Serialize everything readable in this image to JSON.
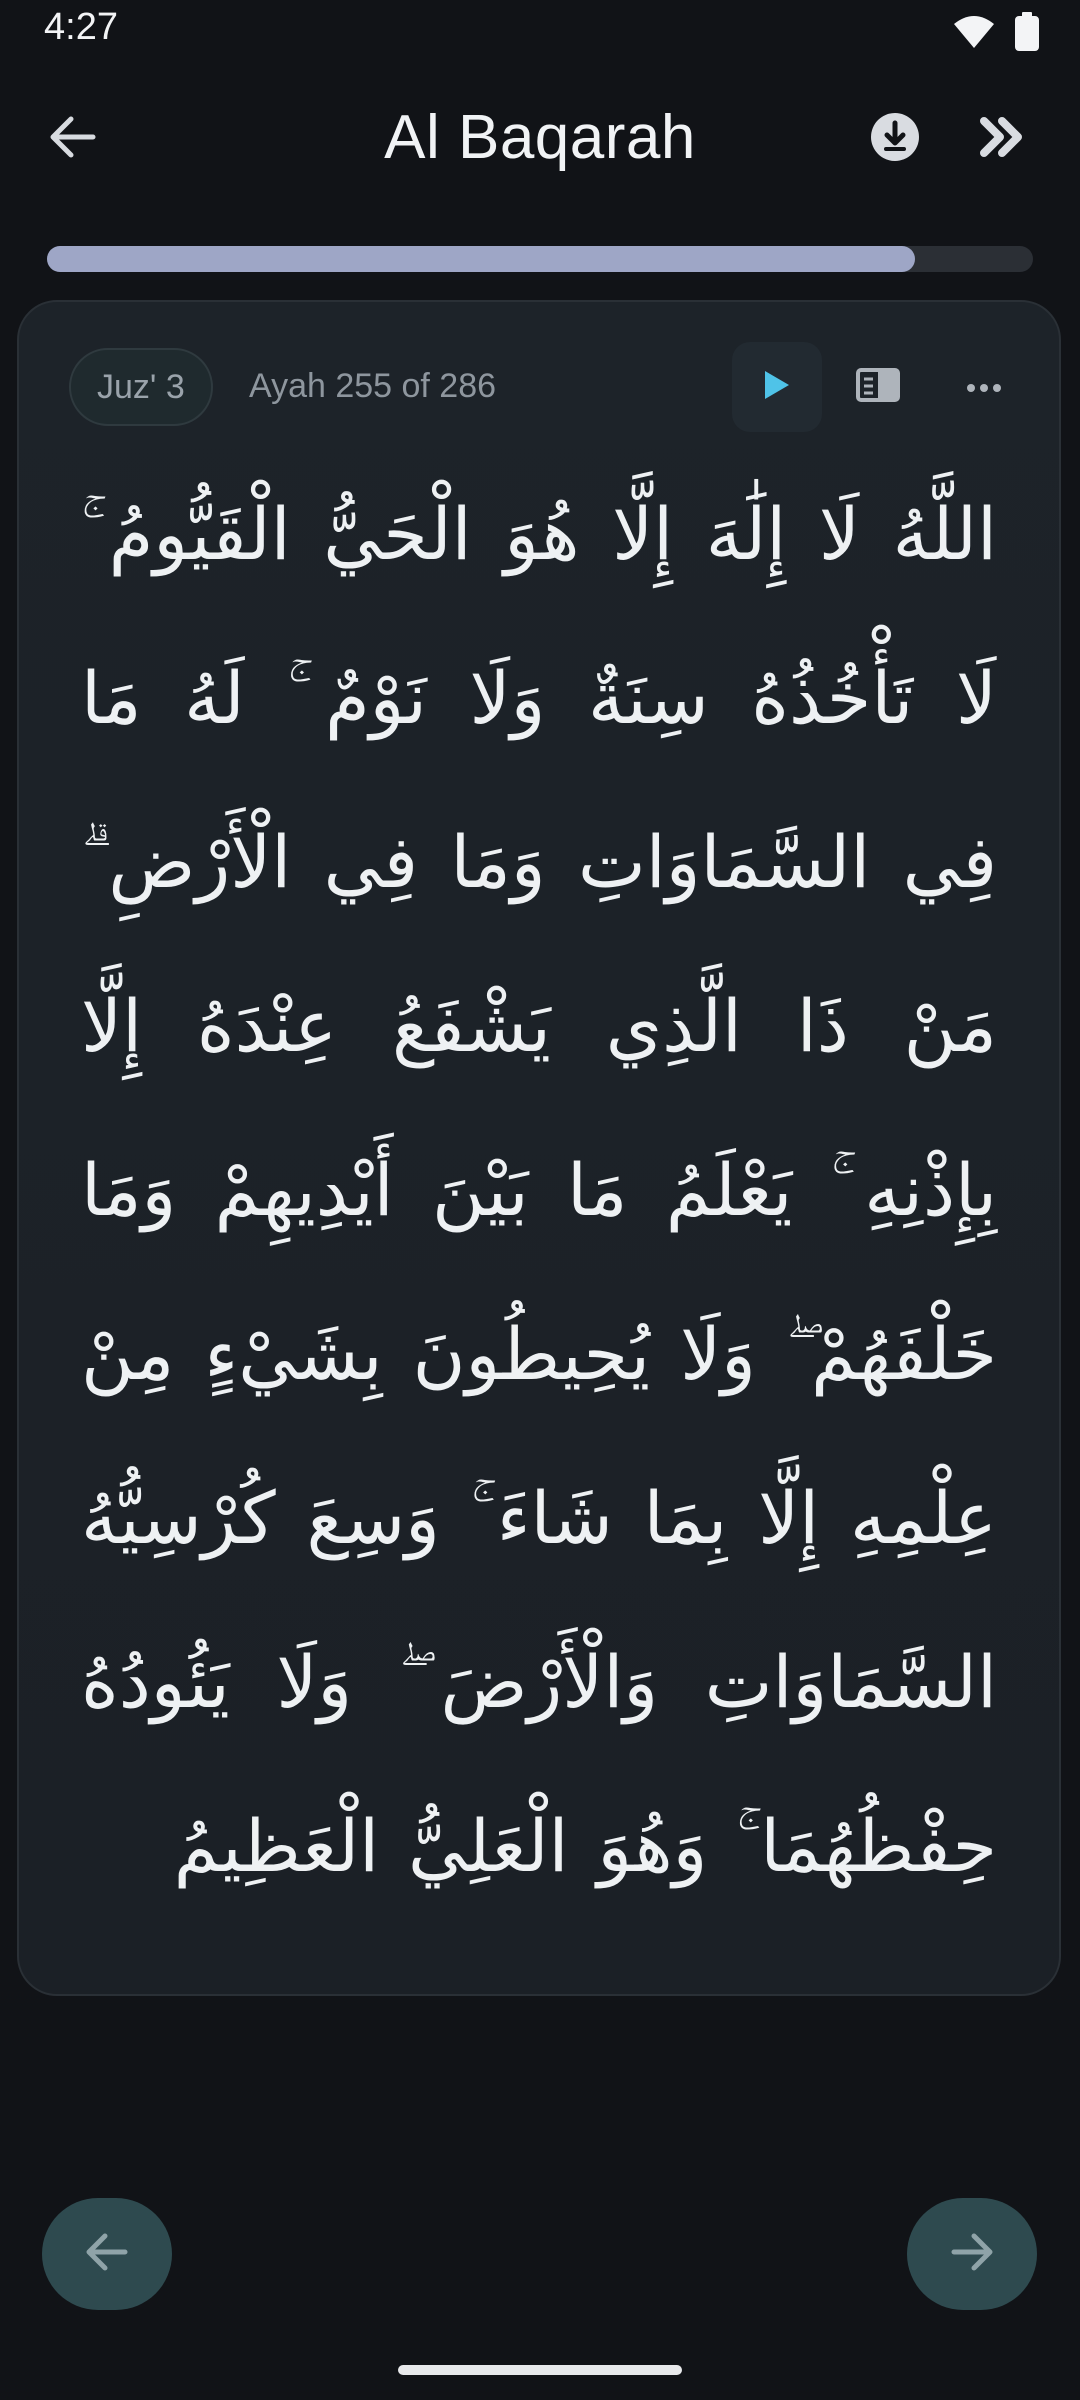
{
  "status_bar": {
    "time": "4:27",
    "icons": [
      "wifi-icon",
      "battery-icon"
    ]
  },
  "app_bar": {
    "title": "Al Baqarah",
    "back_icon": "arrow-left-icon",
    "download_icon": "download-circle-icon",
    "next_icon": "double-chevron-right-icon"
  },
  "progress": {
    "fraction": 0.88,
    "color": "#9ea6c6"
  },
  "card": {
    "juz_label": "Juz' 3",
    "ayah_label": "Ayah 255 of 286",
    "play_icon": "play-icon",
    "reader_icon": "reader-mode-icon",
    "more_icon": "more-horizontal-icon",
    "ayah_text": "اللَّهُ لَا إِلَٰهَ إِلَّا هُوَ الْحَيُّ الْقَيُّومُ ۚ لَا تَأْخُذُهُ سِنَةٌ وَلَا نَوْمٌ ۚ لَهُ مَا فِي السَّمَاوَاتِ وَمَا فِي الْأَرْضِ ۗ مَنْ ذَا الَّذِي يَشْفَعُ عِنْدَهُ إِلَّا بِإِذْنِهِ ۚ يَعْلَمُ مَا بَيْنَ أَيْدِيهِمْ وَمَا خَلْفَهُمْ ۖ وَلَا يُحِيطُونَ بِشَيْءٍ مِنْ عِلْمِهِ إِلَّا بِمَا شَاءَ ۚ وَسِعَ كُرْسِيُّهُ السَّمَاوَاتِ وَالْأَرْضَ ۖ وَلَا يَئُودُهُ حِفْظُهُمَا ۚ وَهُوَ الْعَلِيُّ الْعَظِيمُ"
  },
  "bottom_nav": {
    "prev_icon": "arrow-left-icon",
    "next_icon": "arrow-right-icon",
    "color": "#2e4a4f"
  },
  "colors": {
    "background": "#111317",
    "accent": "#4fc3e8"
  }
}
